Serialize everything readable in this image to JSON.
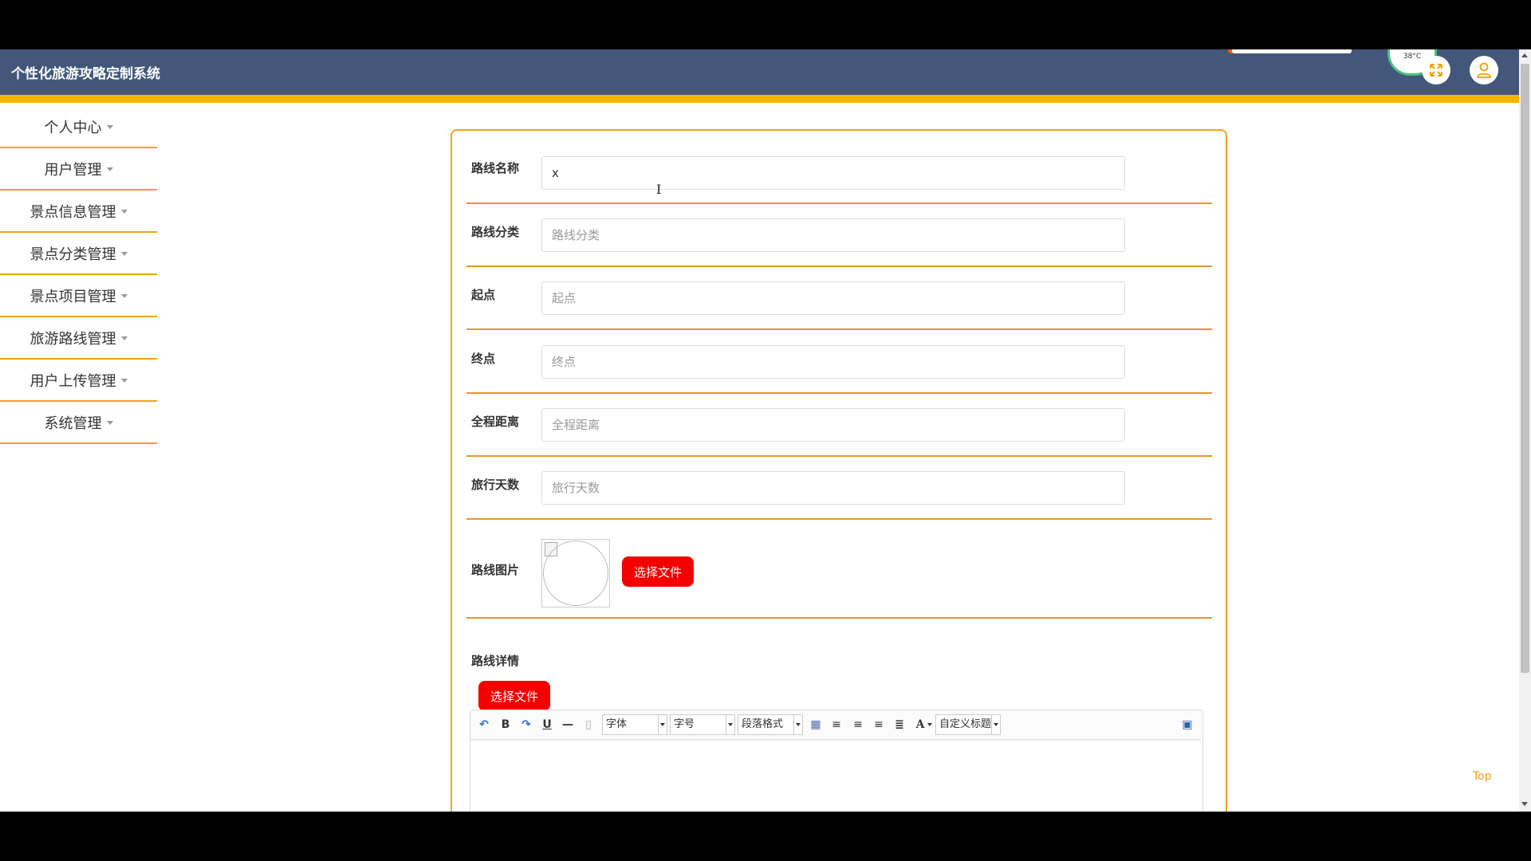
{
  "header": {
    "title": "个性化旅游攻略定制系统",
    "temperature": "38°C",
    "fullscreen_icon": "fullscreen-icon",
    "user_icon": "user-icon"
  },
  "sidebar": {
    "items": [
      {
        "label": "个人中心"
      },
      {
        "label": "用户管理"
      },
      {
        "label": "景点信息管理"
      },
      {
        "label": "景点分类管理"
      },
      {
        "label": "景点项目管理"
      },
      {
        "label": "旅游路线管理"
      },
      {
        "label": "用户上传管理"
      },
      {
        "label": "系统管理"
      }
    ]
  },
  "form": {
    "route_name": {
      "label": "路线名称",
      "value": "x",
      "placeholder": ""
    },
    "route_category": {
      "label": "路线分类",
      "value": "",
      "placeholder": "路线分类"
    },
    "start_point": {
      "label": "起点",
      "value": "",
      "placeholder": "起点"
    },
    "end_point": {
      "label": "终点",
      "value": "",
      "placeholder": "终点"
    },
    "total_distance": {
      "label": "全程距离",
      "value": "",
      "placeholder": "全程距离"
    },
    "travel_days": {
      "label": "旅行天数",
      "value": "",
      "placeholder": "旅行天数"
    },
    "route_image": {
      "label": "路线图片",
      "button": "选择文件"
    },
    "route_detail": {
      "label": "路线详情",
      "button": "选择文件"
    }
  },
  "editor_toolbar": {
    "font_select": "字体",
    "size_select": "字号",
    "paragraph_select": "段落格式",
    "custom_title_select": "自定义标题",
    "font_color_glyph": "A"
  },
  "back_to_top": "Top",
  "colors": {
    "header_bg": "#43577b",
    "accent": "#f8b400",
    "border_orange": "#f0a41a",
    "button_red": "#f40000"
  }
}
